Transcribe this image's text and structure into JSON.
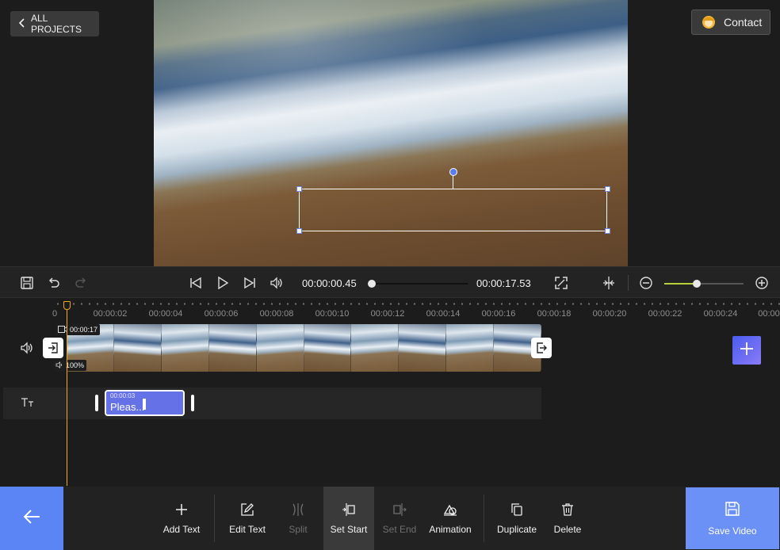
{
  "header": {
    "all_projects_label": "ALL PROJECTS",
    "contact_label": "Contact"
  },
  "playback": {
    "current_time": "00:00:00.45",
    "total_time": "00:00:17.53"
  },
  "timeline": {
    "ticks": [
      "0",
      "00:00:02",
      "00:00:04",
      "00:00:06",
      "00:00:08",
      "00:00:10",
      "00:00:12",
      "00:00:14",
      "00:00:16",
      "00:00:18",
      "00:00:20",
      "00:00:22",
      "00:00:24",
      "00:00"
    ],
    "video_clip_duration": "00:00:17",
    "video_volume": "100%",
    "text_clip_duration": "00:00:03",
    "text_clip_label": "Pleas..."
  },
  "toolbar": {
    "add_text": "Add Text",
    "edit_text": "Edit Text",
    "split": "Split",
    "set_start": "Set Start",
    "set_end": "Set End",
    "animation": "Animation",
    "duplicate": "Duplicate",
    "delete": "Delete",
    "save_video": "Save Video"
  },
  "colors": {
    "accent_blue": "#5b84f5",
    "text_clip": "#6571e6",
    "playhead": "#f0a81c",
    "zoom_fill": "#b6cf3b"
  }
}
